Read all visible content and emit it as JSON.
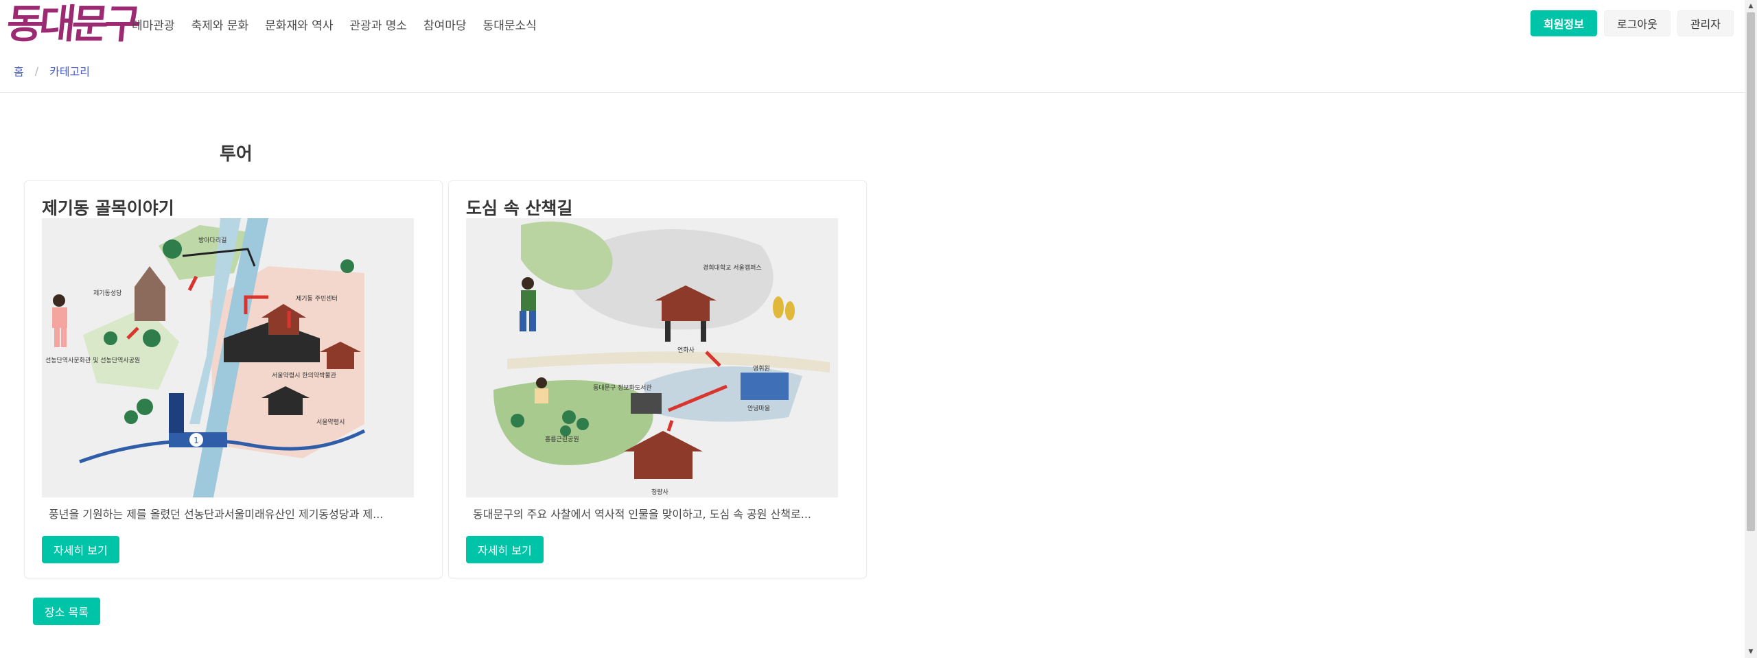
{
  "header": {
    "logo_text": "동대문구",
    "nav": [
      {
        "label": "테마관광"
      },
      {
        "label": "축제와 문화"
      },
      {
        "label": "문화재와 역사"
      },
      {
        "label": "관광과 명소"
      },
      {
        "label": "참여마당"
      },
      {
        "label": "동대문소식"
      }
    ],
    "auth": {
      "member_info": "회원정보",
      "logout": "로그아웃",
      "admin": "관리자"
    }
  },
  "breadcrumb": {
    "home": "홈",
    "separator": "/",
    "category": "카테고리"
  },
  "main": {
    "section_title": "투어",
    "cards": [
      {
        "title": "제기동 골목이야기",
        "description": "풍년을 기원하는 제를 올렸던 선농단과서울미래유산인 제기동성당과 제...",
        "button": "자세히 보기",
        "map_labels": [
          "방아다리길",
          "제기동성당",
          "제기동 주민센터",
          "선농단역사문화관 및 선농단역사공원",
          "서울약령시 한의약박물관",
          "서울약령시",
          "1"
        ]
      },
      {
        "title": "도심 속 산책길",
        "description": "동대문구의 주요 사찰에서 역사적 인물을 맞이하고, 도심 속 공원 산책로...",
        "button": "자세히 보기",
        "map_labels": [
          "경희대학교 서울캠퍼스",
          "연화사",
          "영휘원",
          "안녕마을",
          "동대문구 정보화도서관",
          "홍릉근린공원",
          "청량사"
        ]
      }
    ],
    "places_button": "장소 목록"
  },
  "colors": {
    "brand": "#9c2a73",
    "accent": "#00c4a7",
    "link": "#485fc7"
  }
}
